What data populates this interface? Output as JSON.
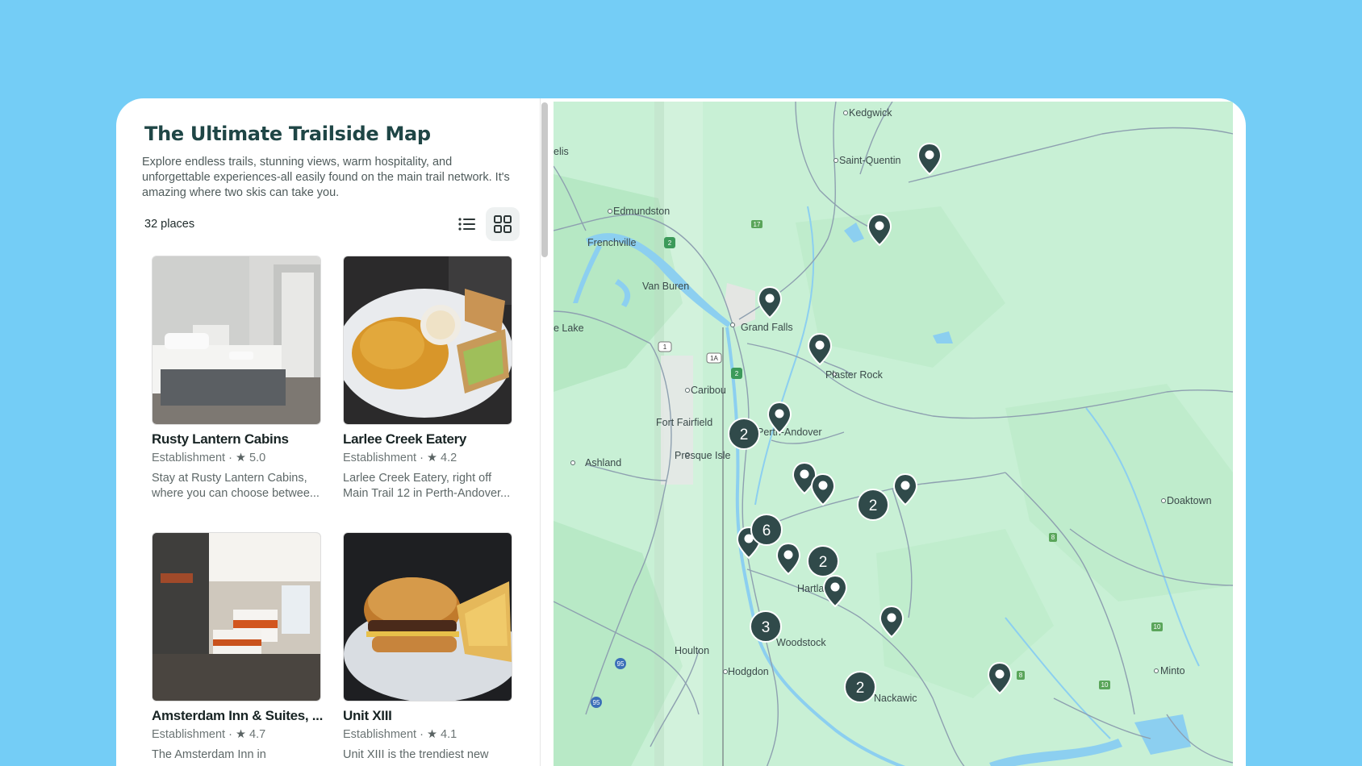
{
  "header": {
    "title": "The Ultimate Trailside Map",
    "description_lines": [
      "Explore endless trails, stunning views, warm hospitality, and",
      "unforgettable experiences-all easily found on the main trail network. It's",
      "amazing where two skis can take you."
    ]
  },
  "toolbar": {
    "count_label": "32 places",
    "view_list_icon": "list-icon",
    "view_grid_icon": "grid-icon",
    "active_view": "grid"
  },
  "places": [
    {
      "name": "Rusty Lantern Cabins",
      "type": "Establishment",
      "rating": "5.0",
      "desc_lines": [
        "Stay at Rusty Lantern Cabins,",
        "where you can choose betwee..."
      ]
    },
    {
      "name": "Larlee Creek Eatery",
      "type": "Establishment",
      "rating": "4.2",
      "desc_lines": [
        "Larlee Creek Eatery, right off",
        "Main Trail 12 in Perth-Andover..."
      ]
    },
    {
      "name": "Amsterdam Inn & Suites, ...",
      "type": "Establishment",
      "rating": "4.7",
      "desc_lines": [
        "The Amsterdam Inn in",
        ""
      ]
    },
    {
      "name": "Unit XIII",
      "type": "Establishment",
      "rating": "4.1",
      "desc_lines": [
        "Unit XIII is the trendiest new",
        ""
      ]
    }
  ],
  "map": {
    "place_labels": [
      "Kedgwick",
      "Saint-Quentin",
      "Edmundston",
      "Frenchville",
      "Van Buren",
      "Grand Falls",
      "Plaster Rock",
      "Caribou",
      "Fort Fairfield",
      "Presque Isle",
      "Ashland",
      "Perth-Andover",
      "Doaktown",
      "Hartland",
      "Woodstock",
      "Houlton",
      "Hodgdon",
      "Minto",
      "Nackawic",
      "elis",
      "e Lake"
    ],
    "clusters": [
      "2",
      "2",
      "6",
      "2",
      "3",
      "2"
    ],
    "route_shields": [
      "17",
      "2",
      "1",
      "1A",
      "2",
      "95",
      "95",
      "8",
      "10",
      "8",
      "10"
    ],
    "colors": {
      "land": "#c8f0d5",
      "water": "#8ccff0",
      "marker": "#304a4a",
      "accent": "#74cdf6"
    }
  }
}
